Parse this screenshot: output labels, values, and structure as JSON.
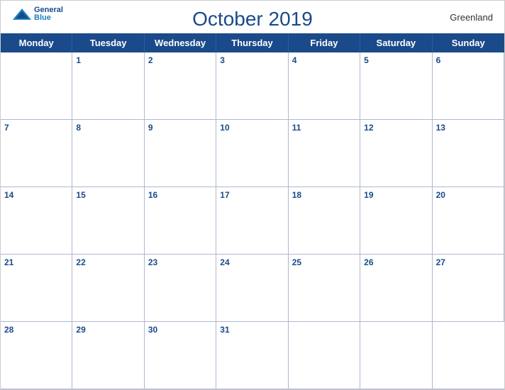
{
  "header": {
    "logo": {
      "general": "General",
      "blue": "Blue"
    },
    "title": "October 2019",
    "region": "Greenland"
  },
  "dayHeaders": [
    "Monday",
    "Tuesday",
    "Wednesday",
    "Thursday",
    "Friday",
    "Saturday",
    "Sunday"
  ],
  "weeks": [
    [
      {
        "date": null
      },
      {
        "date": 1
      },
      {
        "date": 2
      },
      {
        "date": 3
      },
      {
        "date": 4
      },
      {
        "date": 5
      },
      {
        "date": 6
      }
    ],
    [
      {
        "date": 7
      },
      {
        "date": 8
      },
      {
        "date": 9
      },
      {
        "date": 10
      },
      {
        "date": 11
      },
      {
        "date": 12
      },
      {
        "date": 13
      }
    ],
    [
      {
        "date": 14
      },
      {
        "date": 15
      },
      {
        "date": 16
      },
      {
        "date": 17
      },
      {
        "date": 18
      },
      {
        "date": 19
      },
      {
        "date": 20
      }
    ],
    [
      {
        "date": 21
      },
      {
        "date": 22
      },
      {
        "date": 23
      },
      {
        "date": 24
      },
      {
        "date": 25
      },
      {
        "date": 26
      },
      {
        "date": 27
      }
    ],
    [
      {
        "date": 28
      },
      {
        "date": 29
      },
      {
        "date": 30
      },
      {
        "date": 31
      },
      {
        "date": null
      },
      {
        "date": null
      },
      {
        "date": null
      }
    ]
  ],
  "colors": {
    "headerBg": "#1a4a8a",
    "headerText": "#ffffff",
    "rowOdd": "#dde4f0",
    "rowEven": "#ffffff",
    "dateText": "#1a4a8a",
    "border": "#b0b8d0"
  }
}
